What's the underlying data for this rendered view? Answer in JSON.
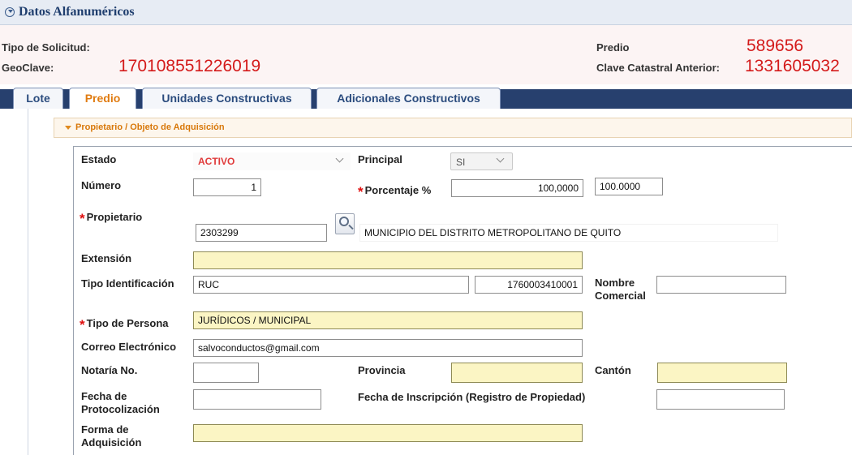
{
  "section_title": "Datos Alfanuméricos",
  "header": {
    "tipo_solicitud_label": "Tipo de Solicitud:",
    "geoclave_label": "GeoClave:",
    "geoclave_value": "170108551226019",
    "predio_label": "Predio",
    "predio_value": "589656",
    "clave_anterior_label": "Clave Catastral Anterior:",
    "clave_anterior_value": "1331605032"
  },
  "tabs": [
    "Lote",
    "Predio",
    "Unidades Constructivas",
    "Adicionales Constructivos"
  ],
  "active_tab": "Predio",
  "subsection_title": "Propietario / Objeto de Adquisición",
  "form": {
    "estado_label": "Estado",
    "estado_value": "ACTIVO",
    "principal_label": "Principal",
    "principal_value": "SI",
    "numero_label": "Número",
    "numero_value": "1",
    "required_mark": "*",
    "porcentaje_label": "Porcentaje %",
    "porcentaje_value": "100,0000",
    "porcentaje_value2": "100.0000",
    "propietario_label": "Propietario",
    "propietario_code": "2303299",
    "propietario_name": "MUNICIPIO DEL DISTRITO METROPOLITANO DE QUITO",
    "extension_label": "Extensión",
    "extension_value": "",
    "tipo_id_label": "Tipo Identificación",
    "tipo_id_value": "RUC",
    "identificacion_value": "1760003410001",
    "nombre_comercial_label1": "Nombre",
    "nombre_comercial_label2": "Comercial",
    "nombre_comercial_value": "",
    "tipo_persona_label": "Tipo de Persona",
    "tipo_persona_value": "JURÍDICOS / MUNICIPAL",
    "correo_label": "Correo Electrónico",
    "correo_value": "salvoconductos@gmail.com",
    "notaria_label": "Notaría No.",
    "notaria_value": "",
    "provincia_label": "Provincia",
    "provincia_value": "",
    "canton_label": "Cantón",
    "canton_value": "",
    "fecha_proto_label1": "Fecha de",
    "fecha_proto_label2": "Protocolización",
    "fecha_proto_value": "",
    "fecha_insc_label": "Fecha de Inscripción (Registro de Propiedad)",
    "fecha_insc_value": "",
    "forma_label1": "Forma de",
    "forma_label2": "Adquisición",
    "forma_value": ""
  },
  "colors": {
    "accent_red": "#d41a1a",
    "tab_active": "#e07b10",
    "tab_rail": "#27406e",
    "required_field": "#fbf5c4"
  }
}
